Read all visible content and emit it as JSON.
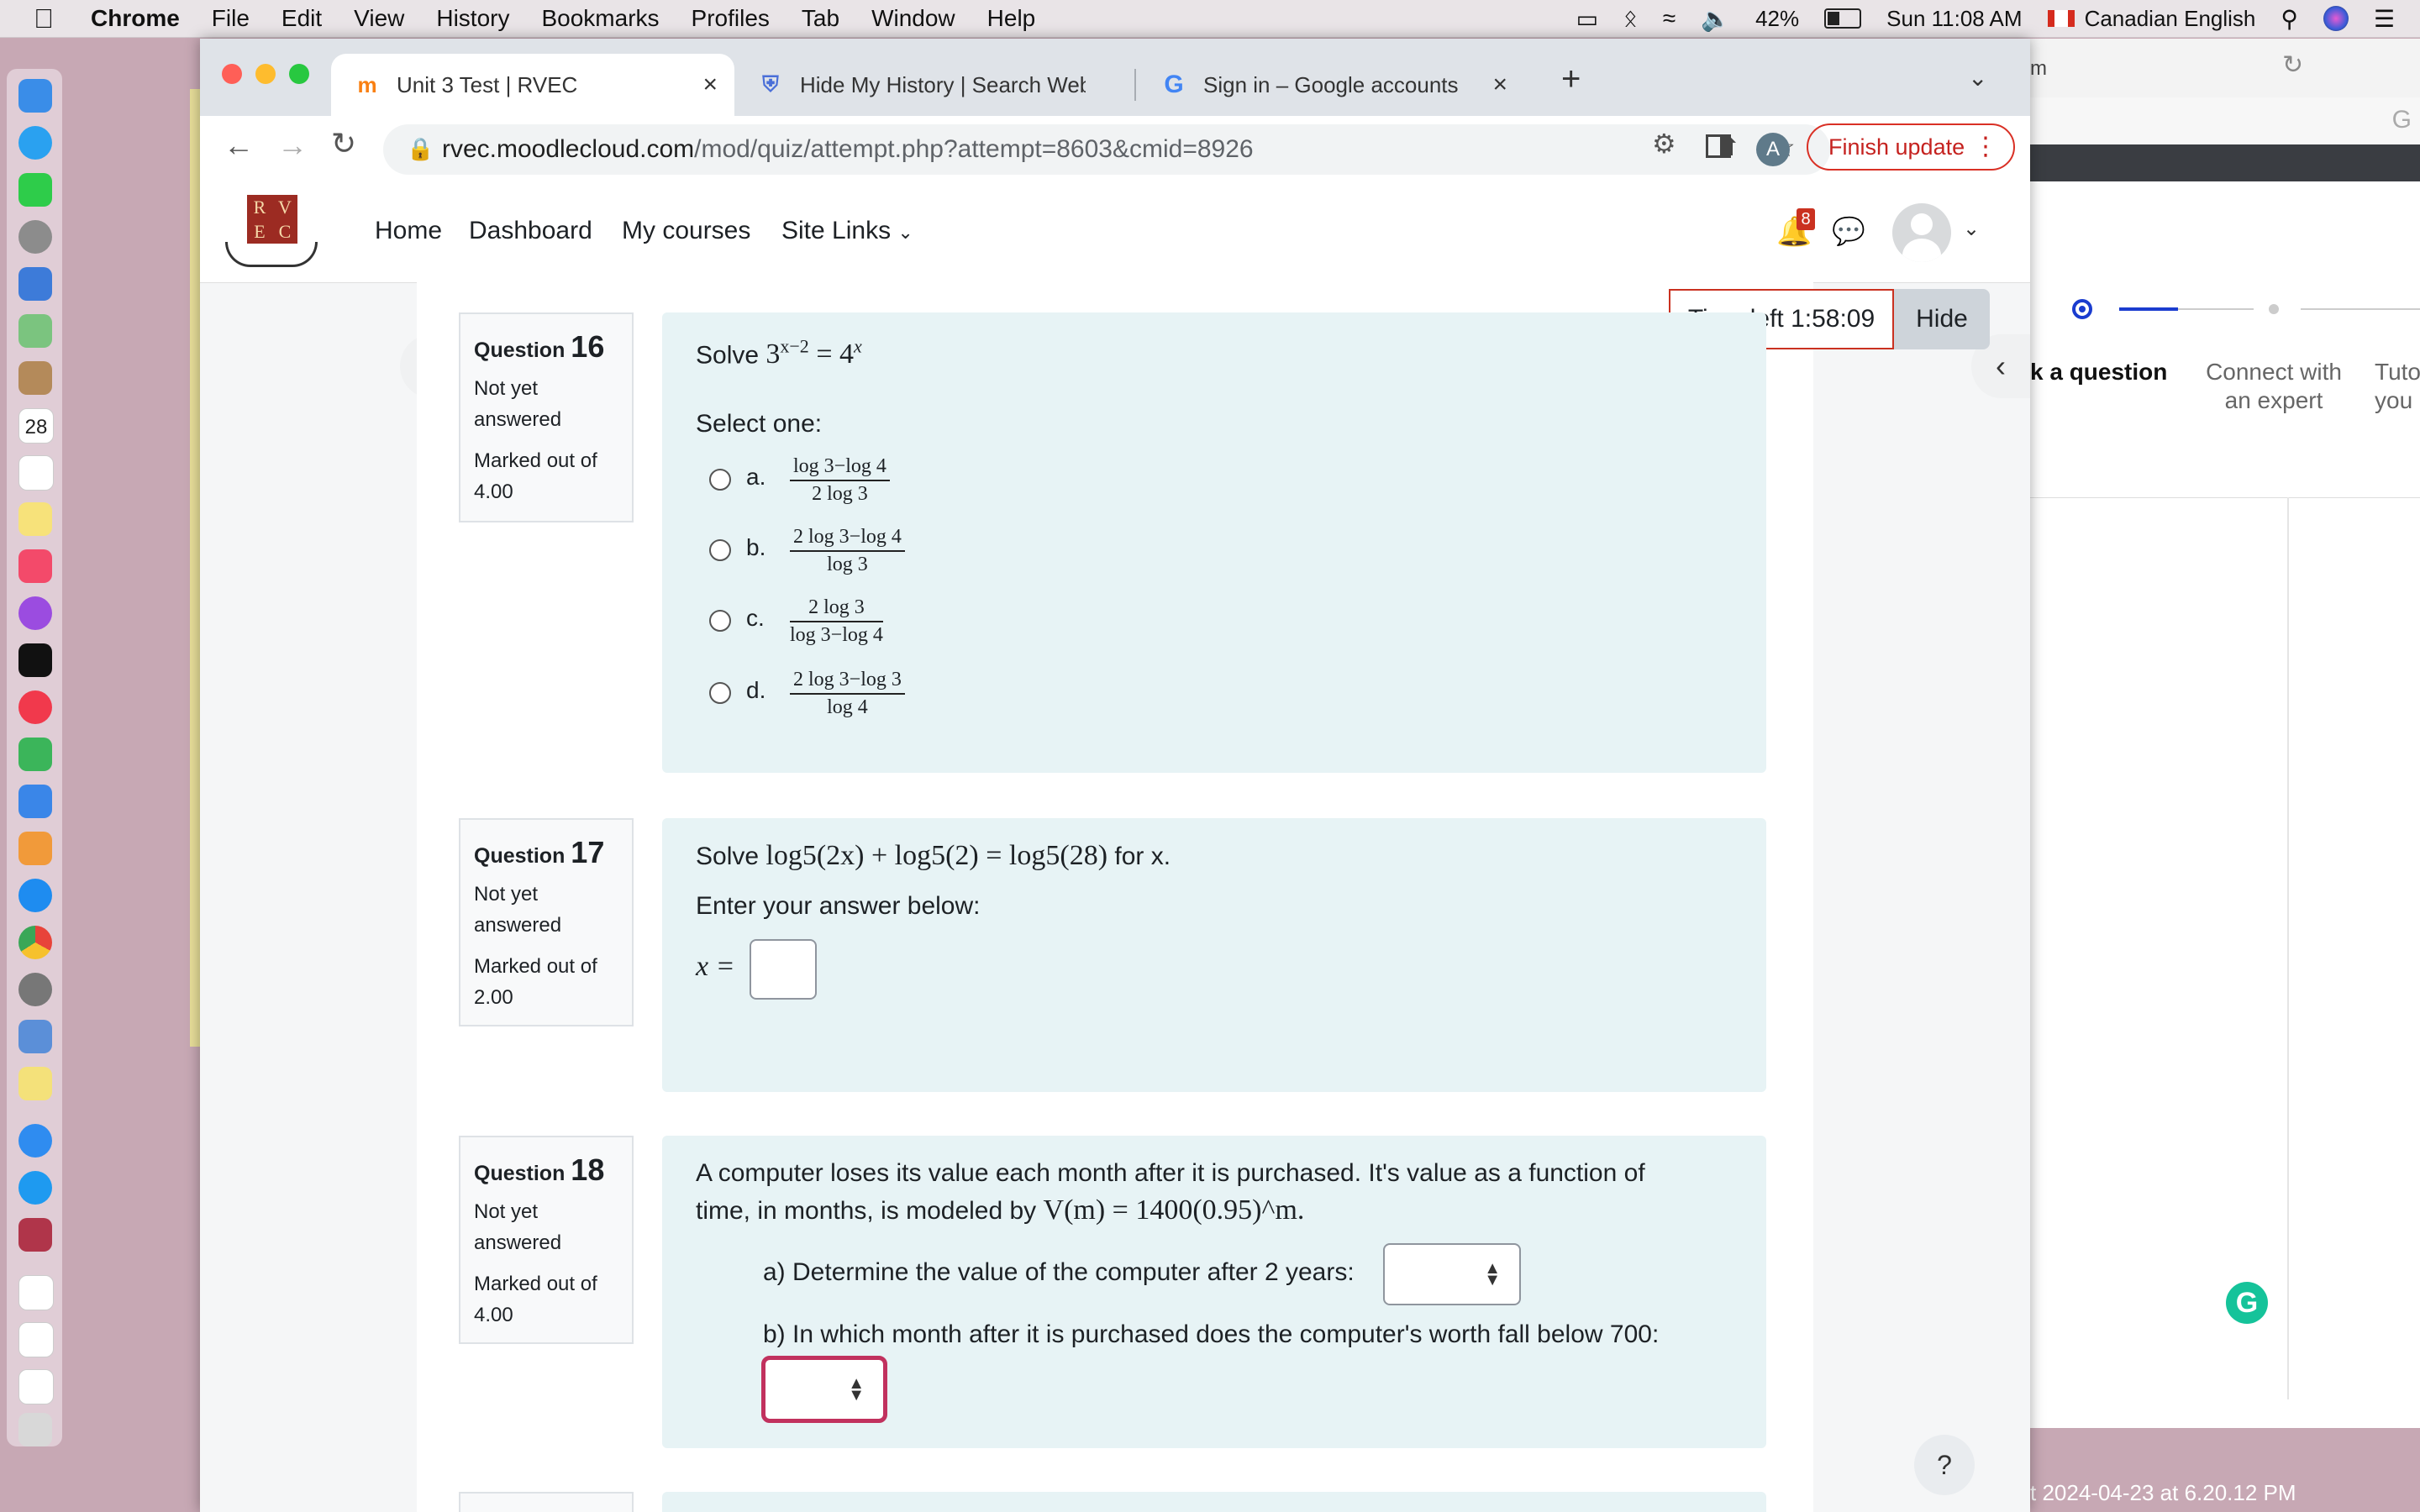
{
  "menubar": {
    "app": "Chrome",
    "items": [
      "File",
      "Edit",
      "View",
      "History",
      "Bookmarks",
      "Profiles",
      "Tab",
      "Window",
      "Help"
    ],
    "battery": "42%",
    "clock": "Sun 11:08 AM",
    "language": "Canadian English"
  },
  "dock": {
    "calendar_day": "28"
  },
  "tabs": [
    {
      "title": "Unit 3 Test | RVEC"
    },
    {
      "title": "Hide My History | Search Web"
    },
    {
      "title": "Sign in – Google accounts"
    }
  ],
  "toolbar": {
    "url_host": "rvec.moodlecloud.com",
    "url_path": "/mod/quiz/attempt.php?attempt=8603&cmid=8926",
    "profile_initial": "A",
    "finish_update": "Finish update"
  },
  "nav": {
    "logo_letters": [
      "R",
      "V",
      "E",
      "C"
    ],
    "links": [
      "Home",
      "Dashboard",
      "My courses",
      "Site Links"
    ],
    "notification_count": "8"
  },
  "timer": {
    "text": "Time left 1:58:09",
    "hide_label": "Hide"
  },
  "questions": [
    {
      "label": "Question",
      "number": "16",
      "status": "Not yet answered",
      "marked": "Marked out of 4.00",
      "prompt": "Solve",
      "equation": "3^(x−2) = 4^x",
      "eq_base1": "3",
      "eq_exp1": "x−2",
      "eq_equals": "=",
      "eq_base2": "4",
      "eq_exp2": "x",
      "select_label": "Select one:",
      "options": [
        {
          "letter": "a.",
          "num": "log 3−log 4",
          "den": "2 log 3"
        },
        {
          "letter": "b.",
          "num": "2 log 3−log 4",
          "den": "log 3"
        },
        {
          "letter": "c.",
          "num": "2 log 3",
          "den": "log 3−log 4"
        },
        {
          "letter": "d.",
          "num": "2 log 3−log 3",
          "den": "log 4"
        }
      ]
    },
    {
      "label": "Question",
      "number": "17",
      "status": "Not yet answered",
      "marked": "Marked out of 2.00",
      "prompt": "Solve",
      "equation": "log5(2x) + log5(2) = log5(28)",
      "suffix": "for x.",
      "instruction": "Enter your answer below:",
      "answer_label": "x =",
      "answer_value": ""
    },
    {
      "label": "Question",
      "number": "18",
      "status": "Not yet answered",
      "marked": "Marked out of 4.00",
      "text_line1": "A computer loses its value each month after it is purchased. It's value as a function of",
      "text_line2_prefix": "time, in months, is modeled by",
      "model": "V(m) = 1400(0.95)^m.",
      "part_a": "a) Determine the value of the computer after 2 years:",
      "part_b": "b) In which month after it is purchased does the computer's worth fall below 700:",
      "select_a_value": "",
      "select_b_value": ""
    }
  ],
  "right_panel": {
    "step1": "k a question",
    "step2": "Connect with an expert",
    "step3": "Tuto you",
    "screenshot_caption": "t 2024-04-23 at 6.20.12 PM",
    "url_fragment": "m"
  },
  "help_button": "?"
}
